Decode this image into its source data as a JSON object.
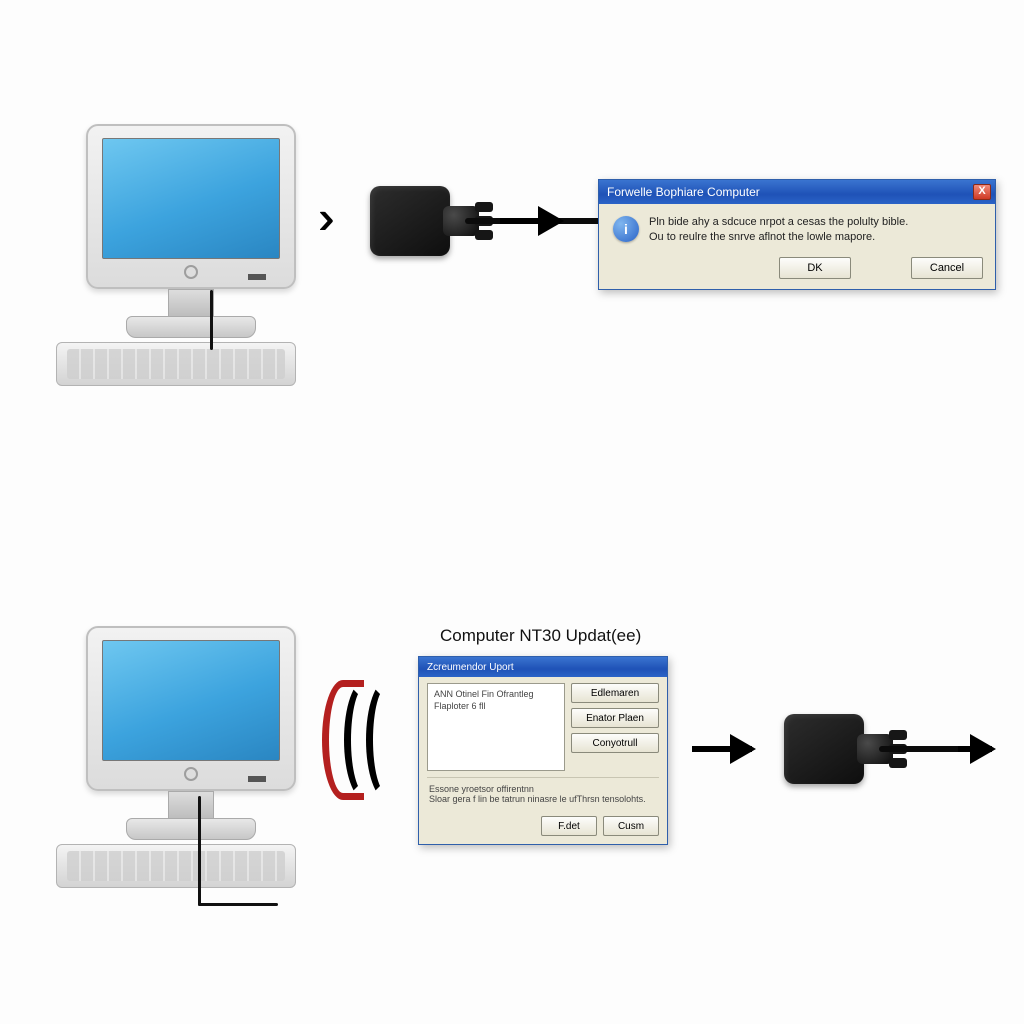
{
  "top": {
    "dialog": {
      "title": "Forwelle Bophiare Computer",
      "line1": "Pln bide ahy a sdcuce nrpot a cesas the polulty bible.",
      "line2": "Ou to reulre the snrve aflnot the lowle mapore.",
      "ok_label": "DK",
      "cancel_label": "Cancel",
      "close_glyph": "X"
    }
  },
  "bottom": {
    "section_title": "Computer  NT30  Updat(ee)",
    "dialog": {
      "title": "Zcreumendor Uport",
      "list_line1": "ANN Otinel Fin Ofrantleg",
      "list_line2": "Flaploter 6 fll",
      "btn1": "Edlemaren",
      "btn2": "Enator Plaen",
      "btn3": "Conyotrull",
      "footer_heading": "Essone yroetsor offirentnn",
      "footer_text": "Sloar gera f lin be tatrun ninasre le ufThrsn tensolohts.",
      "ok_label": "F.det",
      "cancel_label": "Cusm"
    }
  },
  "icons": {
    "info": "i"
  }
}
